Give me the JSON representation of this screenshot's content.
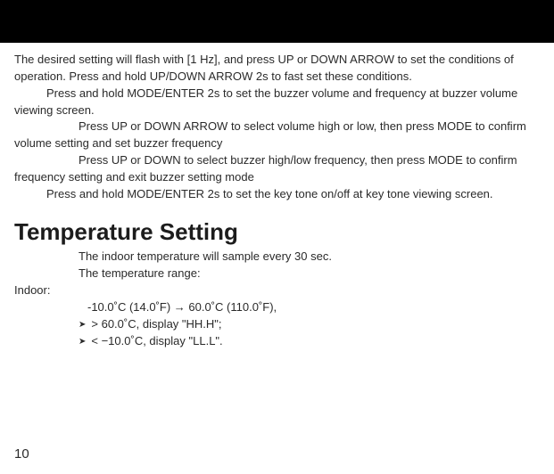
{
  "body": {
    "p1": "The desired setting will flash with [1 Hz], and press UP or DOWN ARROW to set the conditions of operation. Press and hold UP/DOWN ARROW 2s to fast set these conditions.",
    "p2": "Press and hold MODE/ENTER 2s to set the buzzer volume and frequency at buzzer volume viewing screen.",
    "p3": "Press UP or DOWN ARROW to select volume high or low, then press MODE to confirm volume setting and set buzzer frequency",
    "p4": "Press UP or DOWN to select buzzer high/low frequency, then press MODE to confirm frequency setting and exit buzzer setting mode",
    "p5": "Press and hold MODE/ENTER 2s to set the key tone on/off at key tone viewing screen."
  },
  "section": {
    "title": "Temperature Setting",
    "line1": "The indoor temperature will sample every 30 sec.",
    "line2": "The temperature range:",
    "indoor_label": "Indoor:",
    "range": " -10.0˚C (14.0˚F) → 60.0˚C (110.0˚F),",
    "over": "> 60.0˚C, display \"HH.H\";",
    "under": "< −10.0˚C, display \"LL.L\"."
  },
  "icons": {
    "bullet": "➤"
  },
  "page_number": "10"
}
